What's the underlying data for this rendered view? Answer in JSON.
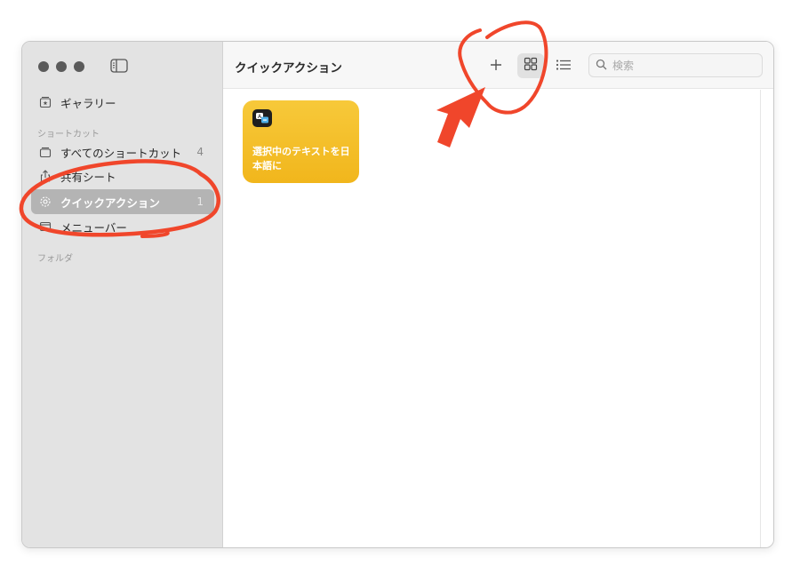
{
  "sidebar": {
    "gallery_label": "ギャラリー",
    "section_shortcuts": "ショートカット",
    "items": [
      {
        "label": "すべてのショートカット",
        "count": "4"
      },
      {
        "label": "共有シート",
        "count": ""
      },
      {
        "label": "クイックアクション",
        "count": "1"
      },
      {
        "label": "メニューバー",
        "count": ""
      }
    ],
    "section_folders": "フォルダ"
  },
  "toolbar": {
    "title": "クイックアクション",
    "add_icon": "plus-icon",
    "grid_icon": "grid-view-icon",
    "list_icon": "list-view-icon",
    "search_placeholder": "検索"
  },
  "shortcuts": [
    {
      "title": "選択中のテキストを日本語に",
      "color": "#f4bf2a",
      "icon": "translate-icon"
    }
  ],
  "colors": {
    "sidebar_bg": "#e3e3e3",
    "selected_row": "#b4b4b4",
    "card_yellow": "#f4bf2a",
    "annotation_red": "#f0462b"
  }
}
